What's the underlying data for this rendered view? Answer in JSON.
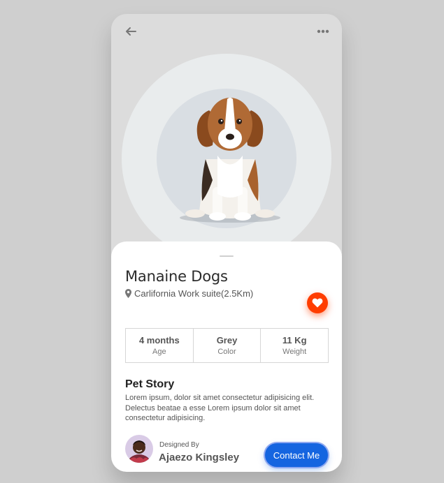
{
  "pet": {
    "name": "Manaine Dogs",
    "location": "Carlifornia Work suite(2.5Km)",
    "stats": [
      {
        "value": "4 months",
        "label": "Age"
      },
      {
        "value": "Grey",
        "label": "Color"
      },
      {
        "value": "11 Kg",
        "label": "Weight"
      }
    ],
    "story_title": "Pet Story",
    "story_text": "Lorem ipsum, dolor sit amet consectetur adipisicing elit. Delectus beatae a esse Lorem ipsum dolor sit amet consectetur adipisicing."
  },
  "designer": {
    "caption": "Designed By",
    "name": "Ajaezo Kingsley"
  },
  "actions": {
    "contact_label": "Contact Me"
  },
  "icons": {
    "back": "arrow-left-icon",
    "more": "more-horizontal-icon",
    "location": "map-pin-icon",
    "favorite": "heart-icon"
  },
  "colors": {
    "accent_heart": "#ff3d00",
    "accent_button": "#1565e0",
    "background": "#cfcfcf"
  }
}
